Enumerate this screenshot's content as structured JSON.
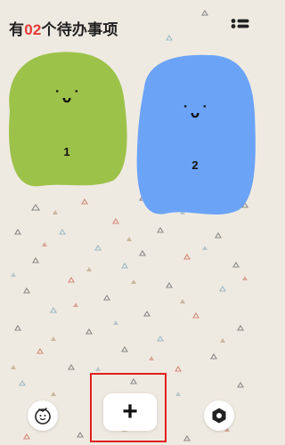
{
  "header": {
    "title_prefix": "有",
    "count": "02",
    "title_suffix": "个待办事项"
  },
  "cards": [
    {
      "number": "1",
      "face": "˙ᴗ˙",
      "color": "#9dc24a"
    },
    {
      "number": "2",
      "face": "˙ᴗ˙",
      "color": "#6ba3f7"
    }
  ],
  "toolbar": {
    "add_label": "+"
  },
  "colors": {
    "background": "#efeae1",
    "accent": "#e53935",
    "highlight": "#e02020"
  },
  "icons": {
    "menu": "list-menu-icon",
    "left": "tomato-face-icon",
    "settings": "settings-hex-icon"
  }
}
